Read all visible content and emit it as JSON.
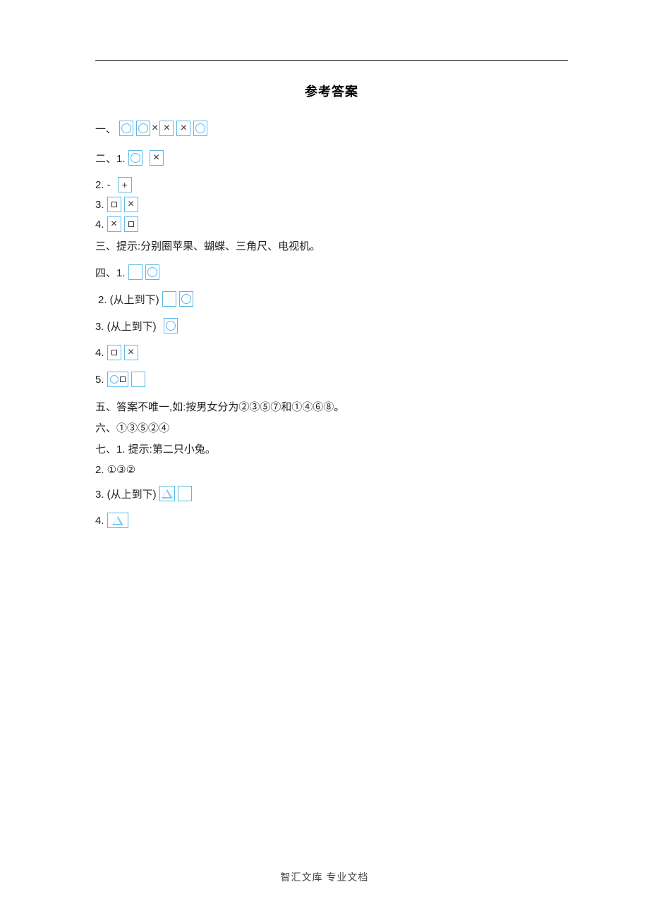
{
  "title": "参考答案",
  "lines": {
    "one_label": "一、",
    "two_label": "二、1.",
    "two_2": "2. -",
    "two_2b": "+",
    "two_3": "3.",
    "two_4": "4.",
    "three": "三、提示:分别圈苹果、蝴蝶、三角尺、电视机。",
    "four_1": "四、1.",
    "four_2": "2. (从上到下)",
    "four_3": "3. (从上到下)",
    "four_4": "4.",
    "four_5": "5.",
    "five": "五、答案不唯一,如:按男女分为②③⑤⑦和①④⑥⑧。",
    "six": "六、①③⑤②④",
    "seven_1": "七、1. 提示:第二只小兔。",
    "seven_2": "2. ①③②",
    "seven_3": "3. (从上到下)",
    "seven_4": "4."
  },
  "footer": "智汇文库  专业文档"
}
